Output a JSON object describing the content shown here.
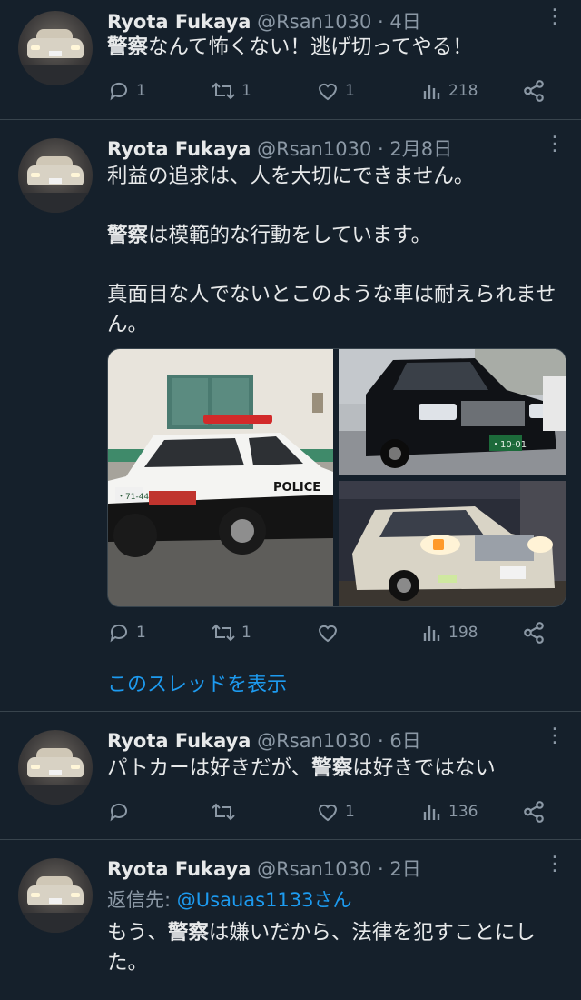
{
  "tweets": [
    {
      "name": "Ryota Fukaya",
      "handle": "@Rsan1030",
      "separator": "·",
      "time": "4日",
      "text_hl": "警察",
      "text_rest": "なんて怖くない！逃げ切ってやる！",
      "replies": "1",
      "retweets": "1",
      "likes": "1",
      "views": "218"
    },
    {
      "name": "Ryota Fukaya",
      "handle": "@Rsan1030",
      "separator": "·",
      "time": "2月8日",
      "para1": "利益の追求は、人を大切にできません。",
      "para2_hl": "警察",
      "para2_rest": "は模範的な行動をしています。",
      "para3": "真面目な人でないとこのような車は耐えられません。",
      "replies": "1",
      "retweets": "1",
      "likes": "",
      "views": "198",
      "photo_text": {
        "police_label": "POLICE",
        "plate1": "・71-44",
        "plate2": "・10-01"
      }
    },
    {
      "name": "Ryota Fukaya",
      "handle": "@Rsan1030",
      "separator": "·",
      "time": "6日",
      "text_a": "パトカーは好きだが、",
      "text_hl": "警察",
      "text_b": "は好きではない",
      "replies": "",
      "retweets": "",
      "likes": "1",
      "views": "136"
    },
    {
      "name": "Ryota Fukaya",
      "handle": "@Rsan1030",
      "separator": "·",
      "time": "2日",
      "reply_prefix": "返信先: ",
      "reply_mention": "@Usauas1133さん",
      "text_a": "もう、",
      "text_hl": "警察",
      "text_b": "は嫌いだから、法律を犯すことにした。"
    }
  ],
  "thread_link": "このスレッドを表示",
  "colors": {
    "background": "#15202b",
    "text": "#e7e9ea",
    "muted": "#8b98a5",
    "accent": "#1d9bf0",
    "divider": "#38444d"
  },
  "icons": [
    "reply-icon",
    "retweet-icon",
    "like-icon",
    "views-icon",
    "share-icon",
    "more-icon"
  ]
}
